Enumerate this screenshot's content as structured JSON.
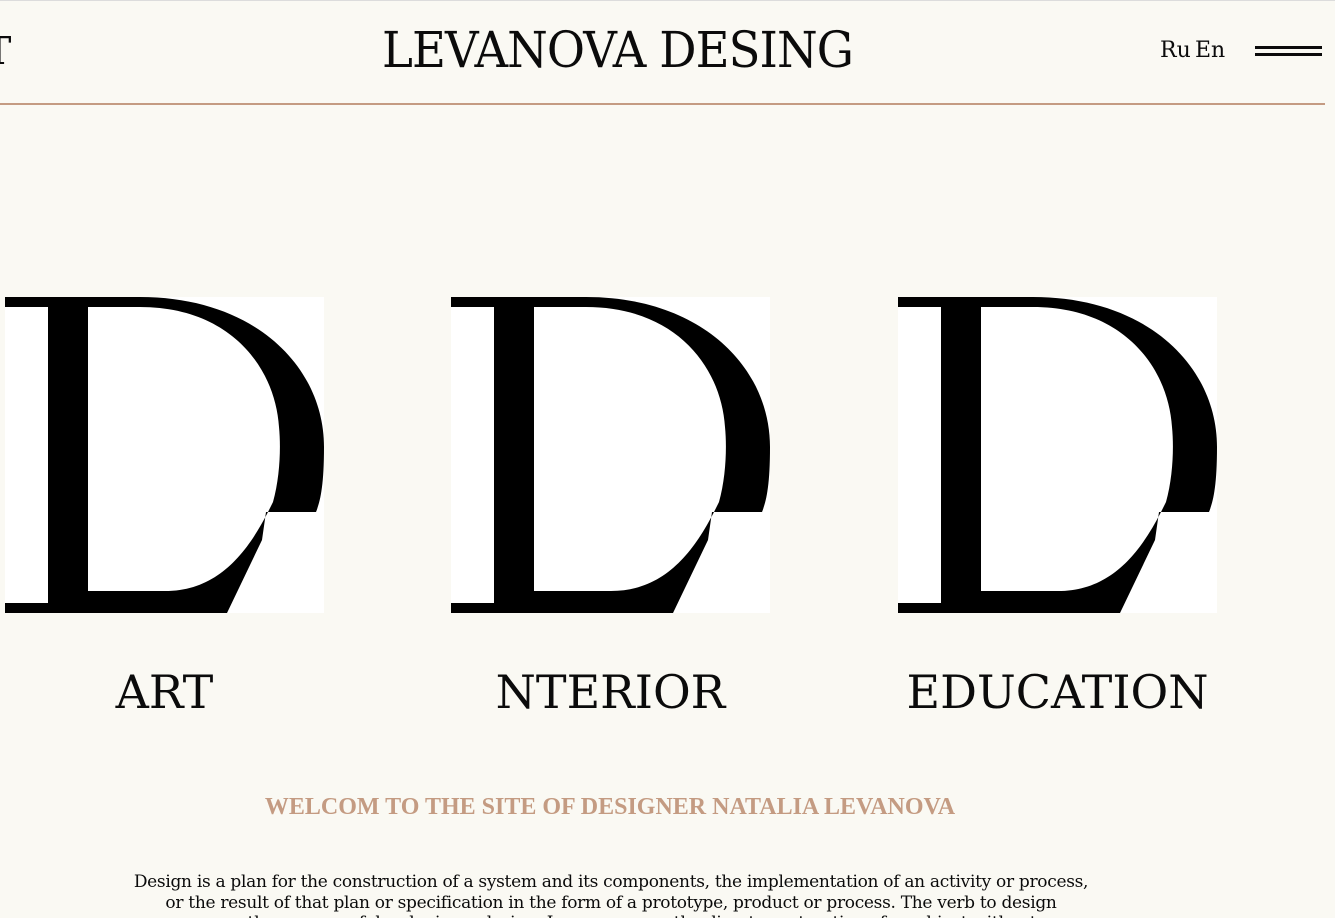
{
  "header": {
    "partial_left_text": "T",
    "brand": "LEVANOVA DESING",
    "lang_ru": "Ru",
    "lang_en": "En",
    "menu_icon": "hamburger-icon"
  },
  "categories": [
    {
      "label": "ART",
      "image_icon": "letter-d-logo"
    },
    {
      "label": "NTERIOR",
      "image_icon": "letter-d-logo"
    },
    {
      "label": "EDUCATION",
      "image_icon": "letter-d-logo"
    }
  ],
  "welcome": {
    "title": "WELCOM TO THE SITE OF DESIGNER NATALIA LEVANOVA",
    "description": "Design is a plan for the construction of a system and its components, the implementation of an activity or process, or the result of that plan or specification in the form of a prototype, product or process. The verb to design expresses the process of developing a design. In some cases, the direct construction of an object without an"
  },
  "colors": {
    "background": "#faf9f3",
    "accent": "#c49b82",
    "text": "#0b0b0b",
    "tile": "#ffffff"
  }
}
